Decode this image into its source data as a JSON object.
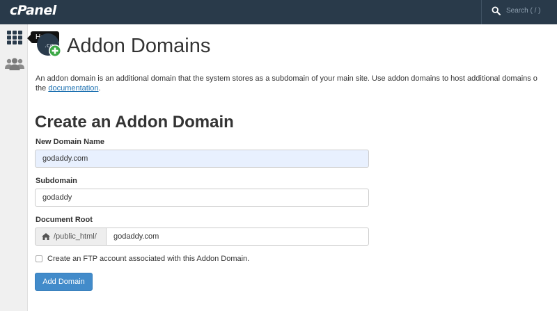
{
  "app": {
    "logo": "cPanel"
  },
  "search": {
    "placeholder": "Search ( / )"
  },
  "sidebar": {
    "items": [
      {
        "icon": "grid-icon",
        "tooltip": "Home"
      },
      {
        "icon": "users-icon"
      }
    ]
  },
  "page": {
    "title": "Addon Domains",
    "description_line1": "An addon domain is an additional domain that the system stores as a subdomain of your main site. Use addon domains to host additional domains o",
    "description_line2_prefix": "the ",
    "description_link": "documentation",
    "description_line2_suffix": "."
  },
  "form": {
    "section_title": "Create an Addon Domain",
    "new_domain_label": "New Domain Name",
    "new_domain_value": "godaddy.com",
    "subdomain_label": "Subdomain",
    "subdomain_value": "godaddy",
    "docroot_label": "Document Root",
    "docroot_prefix": "/public_html/",
    "docroot_value": "godaddy.com",
    "ftp_checkbox_label": "Create an FTP account associated with this Addon Domain.",
    "ftp_checked": false,
    "submit_label": "Add Domain"
  },
  "colors": {
    "topbar": "#293a4a",
    "primary_button": "#428bca",
    "link": "#1a6fb0",
    "autofill": "#e8f0fe"
  }
}
